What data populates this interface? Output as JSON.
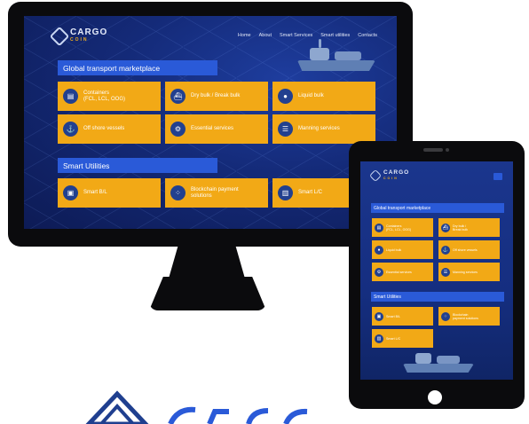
{
  "brand": {
    "name": "CARGO",
    "sub": "COIN"
  },
  "nav": [
    "Home",
    "About",
    "Smart Services",
    "Smart utilities",
    "Contacts"
  ],
  "sections": {
    "marketplace": "Global transport marketplace",
    "utilities": "Smart Utilities"
  },
  "desktop_cards": [
    {
      "label": "Containers",
      "label2": "(FCL, LCL, OOG)",
      "icon": "container-icon"
    },
    {
      "label": "Dry bulk / Break bulk",
      "label2": "",
      "icon": "ship-icon"
    },
    {
      "label": "Liquid bulk",
      "label2": "",
      "icon": "drop-icon"
    },
    {
      "label": "Off shore vessels",
      "label2": "",
      "icon": "vessel-icon"
    },
    {
      "label": "Essential services",
      "label2": "",
      "icon": "gear-icon"
    },
    {
      "label": "Manning services",
      "label2": "",
      "icon": "crew-icon"
    },
    {
      "label": "Smart B/L",
      "label2": "",
      "icon": "folder-icon"
    },
    {
      "label": "Blockchain payment",
      "label2": "solutions",
      "icon": "blockchain-icon"
    },
    {
      "label": "Smart L/C",
      "label2": "",
      "icon": "document-icon"
    }
  ],
  "tablet_cards": [
    {
      "label": "Containers",
      "label2": "(FCL, LCL, OOG)"
    },
    {
      "label": "Dry bulk /",
      "label2": "Break bulk"
    },
    {
      "label": "Liquid bulk",
      "label2": ""
    },
    {
      "label": "Off shore vessels",
      "label2": ""
    },
    {
      "label": "Essential services",
      "label2": ""
    },
    {
      "label": "Manning services",
      "label2": ""
    },
    {
      "label": "Smart B/L",
      "label2": ""
    },
    {
      "label": "Blockchain",
      "label2": "payment solutions"
    },
    {
      "label": "Smart L/C",
      "label2": ""
    }
  ],
  "colors": {
    "accent": "#f2a916",
    "section": "#2a5ad8",
    "background": "#142a78"
  }
}
